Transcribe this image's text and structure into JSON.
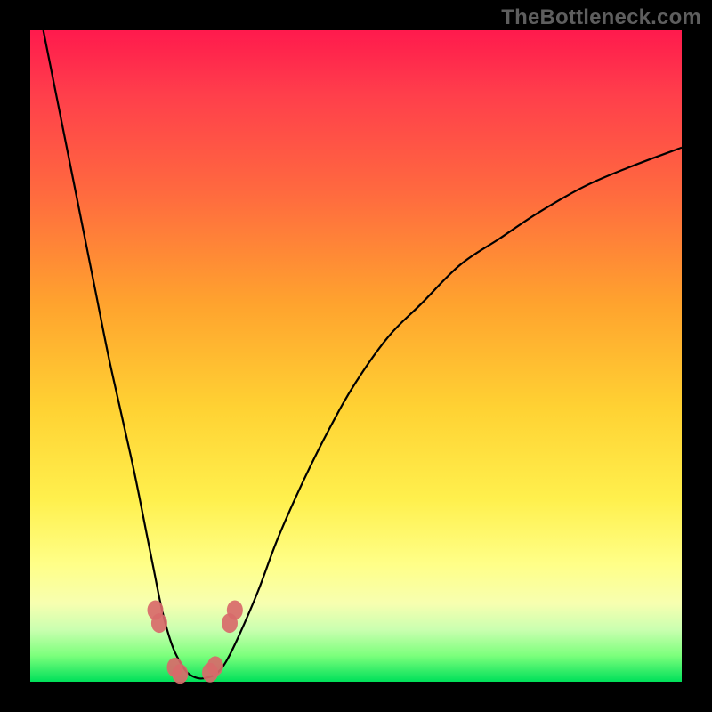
{
  "watermark_text": "TheBottleneck.com",
  "chart_data": {
    "type": "line",
    "title": "",
    "xlabel": "",
    "ylabel": "",
    "xlim": [
      0,
      100
    ],
    "ylim": [
      0,
      100
    ],
    "grid": false,
    "legend": false,
    "series": [
      {
        "name": "bottleneck-curve",
        "color": "#000000",
        "x": [
          2,
          4,
          6,
          8,
          10,
          12,
          14,
          16,
          18,
          19,
          20,
          21,
          22,
          23,
          24,
          25,
          26,
          27,
          28.5,
          30,
          32,
          35,
          38,
          42,
          46,
          50,
          55,
          60,
          66,
          72,
          78,
          85,
          92,
          100
        ],
        "y": [
          100,
          90,
          80,
          70,
          60,
          50,
          41,
          32,
          22,
          17,
          12,
          8,
          5,
          3,
          1.5,
          0.8,
          0.5,
          0.6,
          1.2,
          3,
          7,
          14,
          22,
          31,
          39,
          46,
          53,
          58,
          64,
          68,
          72,
          76,
          79,
          82
        ]
      }
    ],
    "clusters": [
      {
        "name": "left-marker-cluster",
        "color": "#d86a6a",
        "points": [
          {
            "x": 19.2,
            "y": 11.0
          },
          {
            "x": 19.8,
            "y": 9.0
          },
          {
            "x": 22.2,
            "y": 2.2
          },
          {
            "x": 23.0,
            "y": 1.2
          }
        ]
      },
      {
        "name": "right-marker-cluster",
        "color": "#d86a6a",
        "points": [
          {
            "x": 27.6,
            "y": 1.4
          },
          {
            "x": 28.4,
            "y": 2.4
          },
          {
            "x": 30.6,
            "y": 9.0
          },
          {
            "x": 31.4,
            "y": 11.0
          }
        ]
      }
    ],
    "background_gradient_note": "vertical red→orange→yellow→green, rendered via CSS"
  }
}
